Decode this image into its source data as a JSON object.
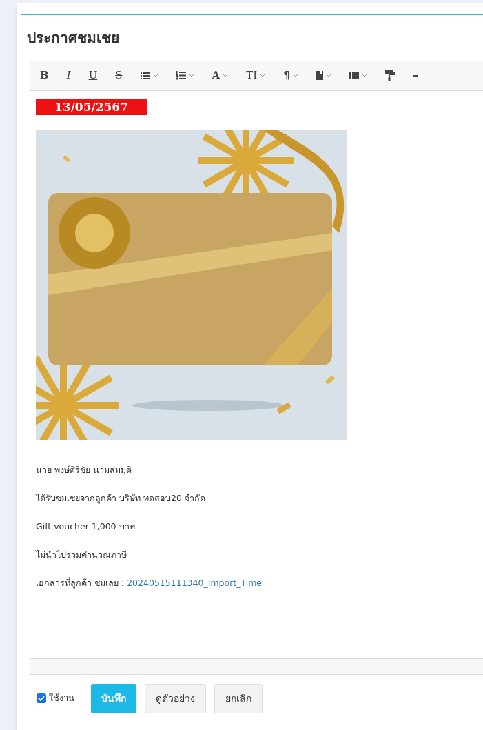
{
  "title": "ประกาศชมเชย",
  "toolbar": [
    {
      "kind": "bold",
      "label": "B",
      "dropdown": false
    },
    {
      "kind": "italic",
      "label": "I",
      "dropdown": false
    },
    {
      "kind": "underline",
      "label": "U",
      "dropdown": false
    },
    {
      "kind": "strike",
      "label": "S",
      "dropdown": false
    },
    {
      "kind": "bullets",
      "dropdown": true
    },
    {
      "kind": "numbers",
      "dropdown": true
    },
    {
      "kind": "color",
      "label": "A",
      "dropdown": true
    },
    {
      "kind": "size",
      "label": "TI",
      "dropdown": true
    },
    {
      "kind": "paragraph",
      "label": "¶",
      "dropdown": true
    },
    {
      "kind": "block",
      "dropdown": true
    },
    {
      "kind": "table",
      "dropdown": true
    },
    {
      "kind": "painter",
      "dropdown": false
    },
    {
      "kind": "more",
      "dropdown": false
    }
  ],
  "content": {
    "date": "13/05/2567",
    "paragraphs": [
      {
        "text": "นาย พงษ์ศิริชัย นามสมมุติ"
      },
      {
        "text": "ได้รับชมเชยจากลูกค้า บริษัท ทดสอบ20 จำกัด"
      },
      {
        "text": "Gift voucher 1,000 บาท"
      },
      {
        "text": "ไม่นำไปรวมคำนวณภาษี"
      },
      {
        "text": "เอกสารที่ลูกค้า ชมเลย : ",
        "link": "20240515111340_Import_Time"
      }
    ]
  },
  "active": {
    "label": "ใช้งาน",
    "checked": true
  },
  "buttons": [
    {
      "label": "บันทึก",
      "kind": "primary"
    },
    {
      "label": "ดูตัวอย่าง",
      "kind": "default"
    },
    {
      "label": "ยกเลิก",
      "kind": "default"
    }
  ]
}
